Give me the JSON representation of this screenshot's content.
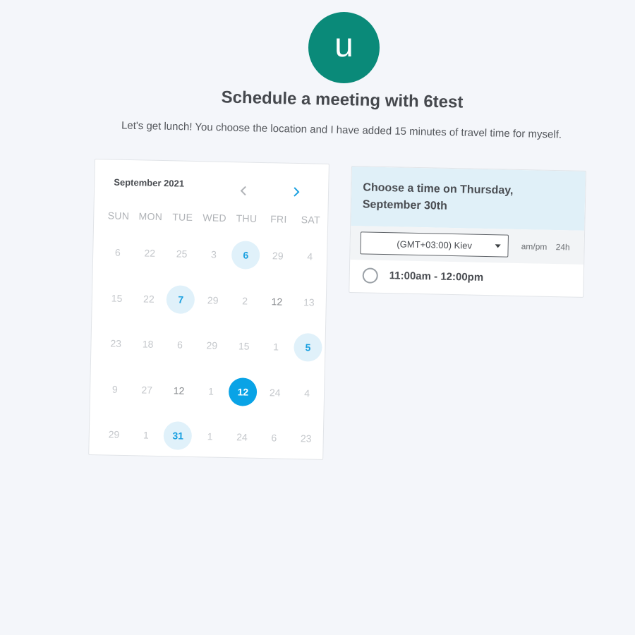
{
  "host": {
    "avatar_initial": "u",
    "avatar_color": "#0a8a79"
  },
  "header": {
    "title": "Schedule a meeting with 6test",
    "description": "Let's get lunch! You choose the location and I have added 15 minutes of travel time for myself."
  },
  "calendar": {
    "month_label": "September 2021",
    "prev_icon": "chevron-left-icon",
    "next_icon": "chevron-right-icon",
    "weekdays": [
      "SUN",
      "MON",
      "TUE",
      "WED",
      "THU",
      "FRI",
      "SAT"
    ],
    "weeks": [
      [
        {
          "d": "6",
          "s": "off"
        },
        {
          "d": "22",
          "s": "off"
        },
        {
          "d": "25",
          "s": "off"
        },
        {
          "d": "3",
          "s": "off"
        },
        {
          "d": "6",
          "s": "avail"
        },
        {
          "d": "29",
          "s": "off"
        },
        {
          "d": "4",
          "s": "off"
        }
      ],
      [
        {
          "d": "15",
          "s": "off"
        },
        {
          "d": "22",
          "s": "off"
        },
        {
          "d": "7",
          "s": "avail"
        },
        {
          "d": "29",
          "s": "off"
        },
        {
          "d": "2",
          "s": "off"
        },
        {
          "d": "12",
          "s": "dark"
        },
        {
          "d": "13",
          "s": "off"
        }
      ],
      [
        {
          "d": "23",
          "s": "off"
        },
        {
          "d": "18",
          "s": "off"
        },
        {
          "d": "6",
          "s": "off"
        },
        {
          "d": "29",
          "s": "off"
        },
        {
          "d": "15",
          "s": "off"
        },
        {
          "d": "1",
          "s": "off"
        },
        {
          "d": "5",
          "s": "avail"
        }
      ],
      [
        {
          "d": "9",
          "s": "off"
        },
        {
          "d": "27",
          "s": "off"
        },
        {
          "d": "12",
          "s": "dark"
        },
        {
          "d": "1",
          "s": "off"
        },
        {
          "d": "12",
          "s": "selected"
        },
        {
          "d": "24",
          "s": "off"
        },
        {
          "d": "4",
          "s": "off"
        }
      ],
      [
        {
          "d": "29",
          "s": "off"
        },
        {
          "d": "1",
          "s": "off"
        },
        {
          "d": "31",
          "s": "avail"
        },
        {
          "d": "1",
          "s": "off"
        },
        {
          "d": "24",
          "s": "off"
        },
        {
          "d": "6",
          "s": "off"
        },
        {
          "d": "23",
          "s": "off"
        }
      ]
    ],
    "accent_color": "#09a3e6"
  },
  "time_panel": {
    "heading_line1": "Choose a time on Thursday,",
    "heading_line2": "September 30th",
    "timezone": "(GMT+03:00) Kiev",
    "format_ampm": "am/pm",
    "format_24h": "24h",
    "slots": [
      "11:00am - 12:00pm"
    ]
  }
}
